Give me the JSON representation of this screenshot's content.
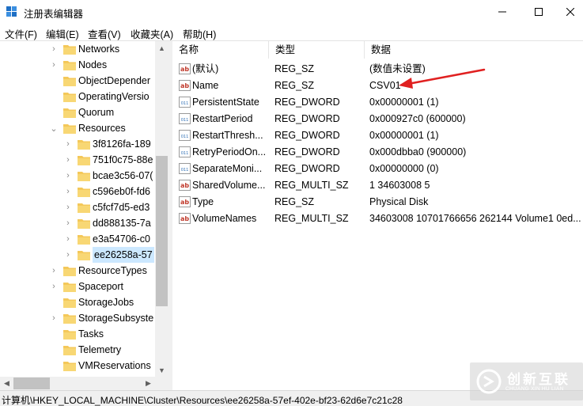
{
  "window": {
    "title": "注册表编辑器"
  },
  "menu": [
    "文件(F)",
    "编辑(E)",
    "查看(V)",
    "收藏夹(A)",
    "帮助(H)"
  ],
  "tree": [
    {
      "label": "Networks",
      "arrow": "›",
      "level": 1
    },
    {
      "label": "Nodes",
      "arrow": "›",
      "level": 1
    },
    {
      "label": "ObjectDepender",
      "arrow": "",
      "level": 1
    },
    {
      "label": "OperatingVersio",
      "arrow": "",
      "level": 1
    },
    {
      "label": "Quorum",
      "arrow": "",
      "level": 1
    },
    {
      "label": "Resources",
      "arrow": "⌄",
      "level": 1
    },
    {
      "label": "3f8126fa-189",
      "arrow": "›",
      "level": 2
    },
    {
      "label": "751f0c75-88e",
      "arrow": "›",
      "level": 2
    },
    {
      "label": "bcae3c56-07(",
      "arrow": "›",
      "level": 2
    },
    {
      "label": "c596eb0f-fd6",
      "arrow": "›",
      "level": 2
    },
    {
      "label": "c5fcf7d5-ed3",
      "arrow": "›",
      "level": 2
    },
    {
      "label": "dd888135-7a",
      "arrow": "›",
      "level": 2
    },
    {
      "label": "e3a54706-c0",
      "arrow": "›",
      "level": 2
    },
    {
      "label": "ee26258a-57",
      "arrow": "›",
      "level": 2,
      "selected": true
    },
    {
      "label": "ResourceTypes",
      "arrow": "›",
      "level": 1
    },
    {
      "label": "Spaceport",
      "arrow": "›",
      "level": 1
    },
    {
      "label": "StorageJobs",
      "arrow": "",
      "level": 1
    },
    {
      "label": "StorageSubsyste",
      "arrow": "›",
      "level": 1
    },
    {
      "label": "Tasks",
      "arrow": "",
      "level": 1
    },
    {
      "label": "Telemetry",
      "arrow": "",
      "level": 1
    },
    {
      "label": "VMReservations",
      "arrow": "",
      "level": 1
    }
  ],
  "columns": [
    "名称",
    "类型",
    "数据"
  ],
  "values": [
    {
      "name": "(默认)",
      "type": "REG_SZ",
      "data": "(数值未设置)",
      "icon": "string-value-icon"
    },
    {
      "name": "Name",
      "type": "REG_SZ",
      "data": "CSV01",
      "icon": "string-value-icon"
    },
    {
      "name": "PersistentState",
      "type": "REG_DWORD",
      "data": "0x00000001 (1)",
      "icon": "binary-value-icon"
    },
    {
      "name": "RestartPeriod",
      "type": "REG_DWORD",
      "data": "0x000927c0 (600000)",
      "icon": "binary-value-icon"
    },
    {
      "name": "RestartThresh...",
      "type": "REG_DWORD",
      "data": "0x00000001 (1)",
      "icon": "binary-value-icon"
    },
    {
      "name": "RetryPeriodOn...",
      "type": "REG_DWORD",
      "data": "0x000dbba0 (900000)",
      "icon": "binary-value-icon"
    },
    {
      "name": "SeparateMoni...",
      "type": "REG_DWORD",
      "data": "0x00000000 (0)",
      "icon": "binary-value-icon"
    },
    {
      "name": "SharedVolume...",
      "type": "REG_MULTI_SZ",
      "data": "1 34603008 5",
      "icon": "string-value-icon"
    },
    {
      "name": "Type",
      "type": "REG_SZ",
      "data": "Physical Disk",
      "icon": "string-value-icon"
    },
    {
      "name": "VolumeNames",
      "type": "REG_MULTI_SZ",
      "data": "34603008 10701766656 262144 Volume1 0ed...",
      "icon": "string-value-icon"
    }
  ],
  "status": {
    "path": "计算机\\HKEY_LOCAL_MACHINE\\Cluster\\Resources\\ee26258a-57ef-402e-bf23-62d6e7c21c28"
  },
  "watermark": {
    "main": "创新互联",
    "sub": "CHUANG XIN HU LIAN"
  },
  "colors": {
    "selection": "#cce8ff",
    "folder": "#f4c85a",
    "arrow_annotation": "#e02020",
    "string_icon": "#c0392b",
    "binary_icon": "#2f6fb5"
  }
}
